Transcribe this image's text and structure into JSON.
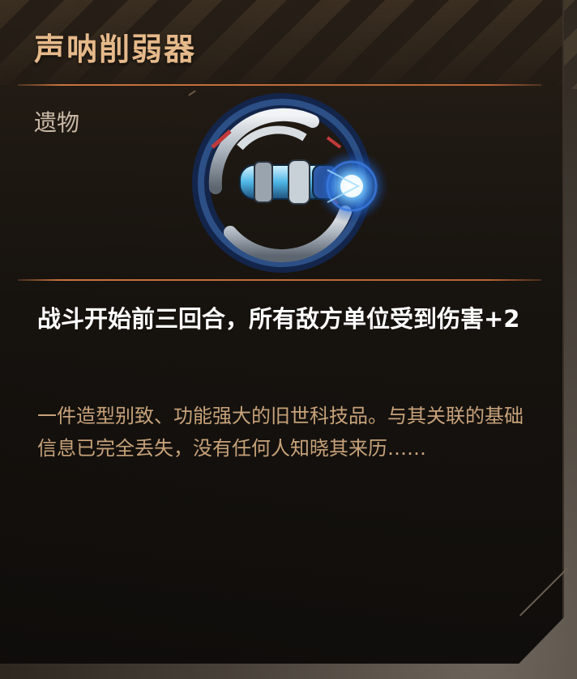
{
  "item": {
    "name": "声呐削弱器",
    "category": "遗物",
    "icon": "sonar-device-icon",
    "effect": "战斗开始前三回合，所有敌方单位受到伤害+2",
    "flavor": "一件造型别致、功能强大的旧世科技品。与其关联的基础信息已完全丢失，没有任何人知晓其来历……"
  },
  "colors": {
    "title": "#e6b98a",
    "divider": "#c9733f",
    "category": "#c9b9a6",
    "effect": "#ffffff",
    "flavor": "#c7a27a",
    "glow": "#4fa3ff"
  }
}
